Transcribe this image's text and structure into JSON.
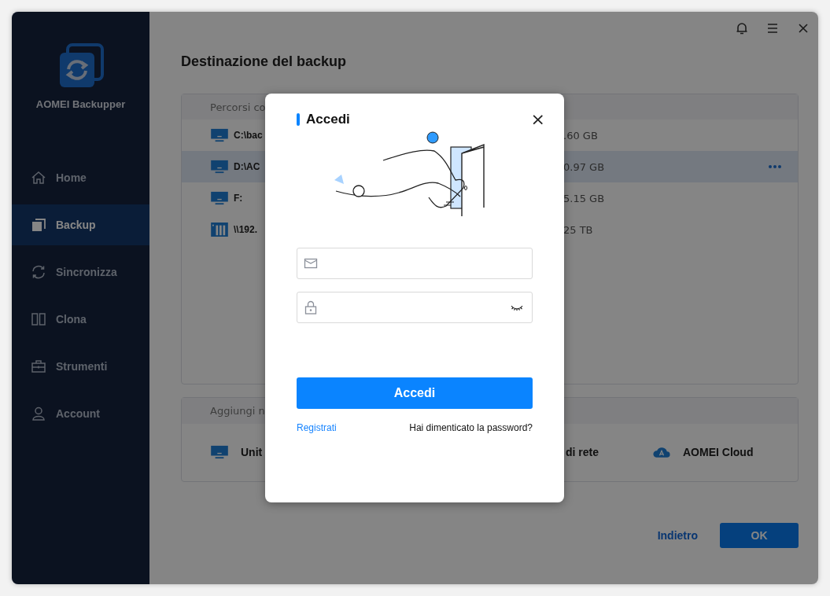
{
  "app": {
    "name": "AOMEI Backupper"
  },
  "nav": [
    {
      "label": "Home",
      "kind": "home",
      "selected": false
    },
    {
      "label": "Backup",
      "kind": "backup",
      "selected": true
    },
    {
      "label": "Sincronizza",
      "kind": "sync",
      "selected": false
    },
    {
      "label": "Clona",
      "kind": "clone",
      "selected": false
    },
    {
      "label": "Strumenti",
      "kind": "tools",
      "selected": false
    },
    {
      "label": "Account",
      "kind": "account",
      "selected": false
    }
  ],
  "page": {
    "title": "Destinazione del backup"
  },
  "paths": {
    "header": "Percorsi co",
    "rows": [
      {
        "kind": "drive",
        "name": "C:\\bac",
        "size": ".60 GB",
        "selected": false
      },
      {
        "kind": "drive",
        "name": "D:\\AC",
        "size": "0.97 GB",
        "selected": true
      },
      {
        "kind": "drive",
        "name": "F:",
        "size": "5.15 GB",
        "selected": false
      },
      {
        "kind": "nas",
        "name": "\\\\192.",
        "size": "25 TB",
        "selected": false
      }
    ]
  },
  "add": {
    "header": "Aggiungi n",
    "items": [
      {
        "kind": "drive",
        "label": "Unit"
      },
      {
        "kind": "none",
        "label": "di rete"
      },
      {
        "kind": "cloud",
        "label": "AOMEI Cloud"
      }
    ]
  },
  "footer": {
    "back": "Indietro",
    "ok": "OK"
  },
  "dialog": {
    "title": "Accedi",
    "close": "×",
    "submit": "Accedi",
    "register": "Registrati",
    "forgot": "Hai dimenticato la password?"
  }
}
